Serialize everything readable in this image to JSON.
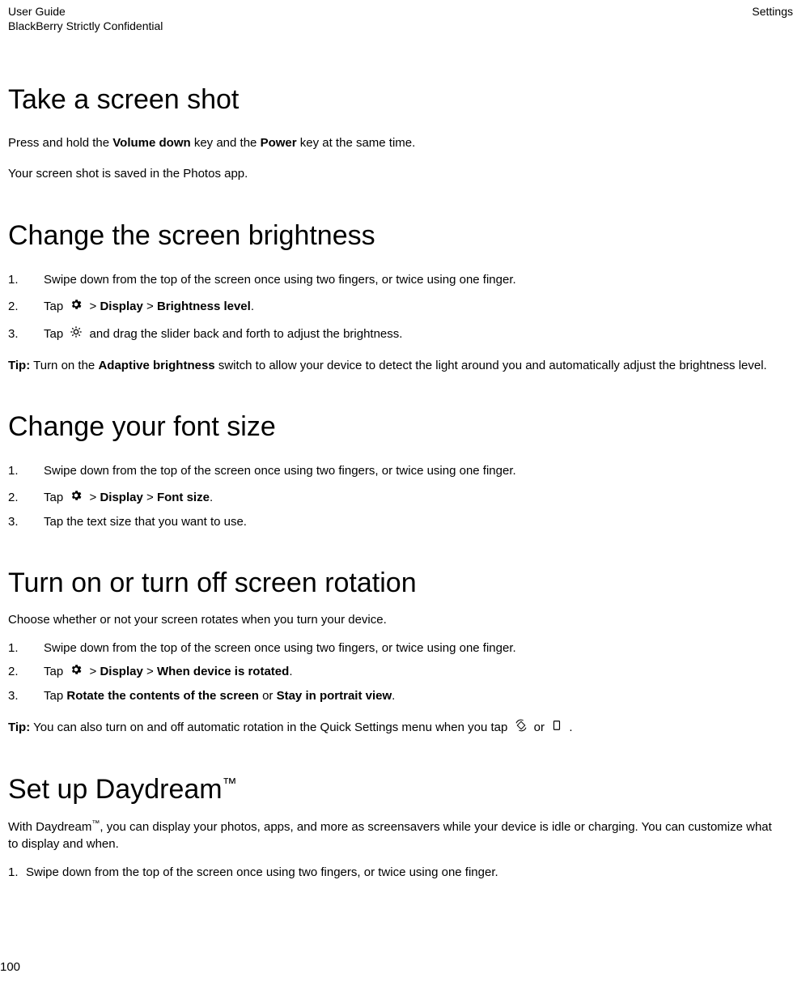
{
  "header": {
    "title": "User Guide",
    "subtitle": "BlackBerry Strictly Confidential",
    "section": "Settings"
  },
  "sections": {
    "screenshot": {
      "heading": "Take a screen shot",
      "p1_pre": "Press and hold the ",
      "p1_b1": "Volume down",
      "p1_mid": " key and the ",
      "p1_b2": "Power",
      "p1_post": " key at the same time.",
      "p2": "Your screen shot is saved in the Photos app."
    },
    "brightness": {
      "heading": "Change the screen brightness",
      "step1": "Swipe down from the top of the screen once using two fingers, or twice using one finger.",
      "step2_pre": "Tap ",
      "step2_mid": " > ",
      "step2_b1": "Display",
      "step2_sep": " > ",
      "step2_b2": "Brightness level",
      "step2_post": ".",
      "step3_pre": "Tap ",
      "step3_post": " and drag the slider back and forth to adjust the brightness.",
      "tip_label": "Tip:",
      "tip_pre": " Turn on the ",
      "tip_b": "Adaptive brightness",
      "tip_post": " switch to allow your device to detect the light around you and automatically adjust the brightness level."
    },
    "fontsize": {
      "heading": "Change your font size",
      "step1": "Swipe down from the top of the screen once using two fingers, or twice using one finger.",
      "step2_pre": "Tap ",
      "step2_mid": " > ",
      "step2_b1": "Display",
      "step2_sep": " > ",
      "step2_b2": "Font size",
      "step2_post": ".",
      "step3": "Tap the text size that you want to use."
    },
    "rotation": {
      "heading": "Turn on or turn off screen rotation",
      "intro": "Choose whether or not your screen rotates when you turn your device.",
      "step1": "Swipe down from the top of the screen once using two fingers, or twice using one finger.",
      "step2_pre": "Tap ",
      "step2_mid": " > ",
      "step2_b1": "Display",
      "step2_sep": " > ",
      "step2_b2": "When device is rotated",
      "step2_post": ".",
      "step3_pre": "Tap ",
      "step3_b1": "Rotate the contents of the screen",
      "step3_mid": " or ",
      "step3_b2": "Stay in portrait view",
      "step3_post": ".",
      "tip_label": "Tip:",
      "tip_pre": " You can also turn on and off automatic rotation in the Quick Settings menu when you tap ",
      "tip_mid": " or ",
      "tip_post": " ."
    },
    "daydream": {
      "heading_pre": "Set up Daydream",
      "tm": "™",
      "intro_pre": "With Daydream",
      "intro_post": ", you can display your photos, apps, and more as screensavers while your device is idle or charging. You can customize what to display and when.",
      "step1": "Swipe down from the top of the screen once using two fingers, or twice using one finger."
    }
  },
  "page_number": "100"
}
